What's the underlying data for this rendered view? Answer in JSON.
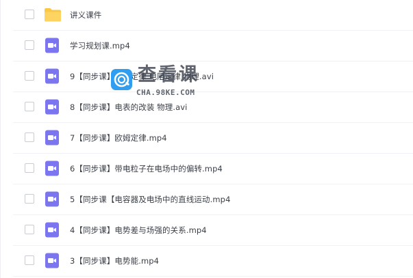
{
  "files": [
    {
      "name": "讲义课件",
      "icon": "folder-icon"
    },
    {
      "name": "学习规划课.mp4",
      "icon": "video-file-icon"
    },
    {
      "name": "9【同步课】焦耳定律 电阻定律 物理.avi",
      "icon": "video-file-icon"
    },
    {
      "name": "8【同步课】电表的改装 物理.avi",
      "icon": "video-file-icon"
    },
    {
      "name": "7【同步课】欧姆定律.mp4",
      "icon": "video-file-icon"
    },
    {
      "name": "6【同步课】带电粒子在电场中的偏转.mp4",
      "icon": "video-file-icon"
    },
    {
      "name": "5【同步课【电容器及电场中的直线运动.mp4",
      "icon": "video-file-icon"
    },
    {
      "name": "4【同步课】电势差与场强的关系.mp4",
      "icon": "video-file-icon"
    },
    {
      "name": "3【同步课】电势能.mp4",
      "icon": "video-file-icon"
    }
  ],
  "watermark": {
    "title": "查看课",
    "url": "CHA.98KE.COM",
    "icon": "watermark-logo-icon"
  },
  "colors": {
    "folder": "#fbc846",
    "video": "#7b75f0",
    "text": "#3b3f48",
    "watermark_blue": "#2f9df0"
  }
}
